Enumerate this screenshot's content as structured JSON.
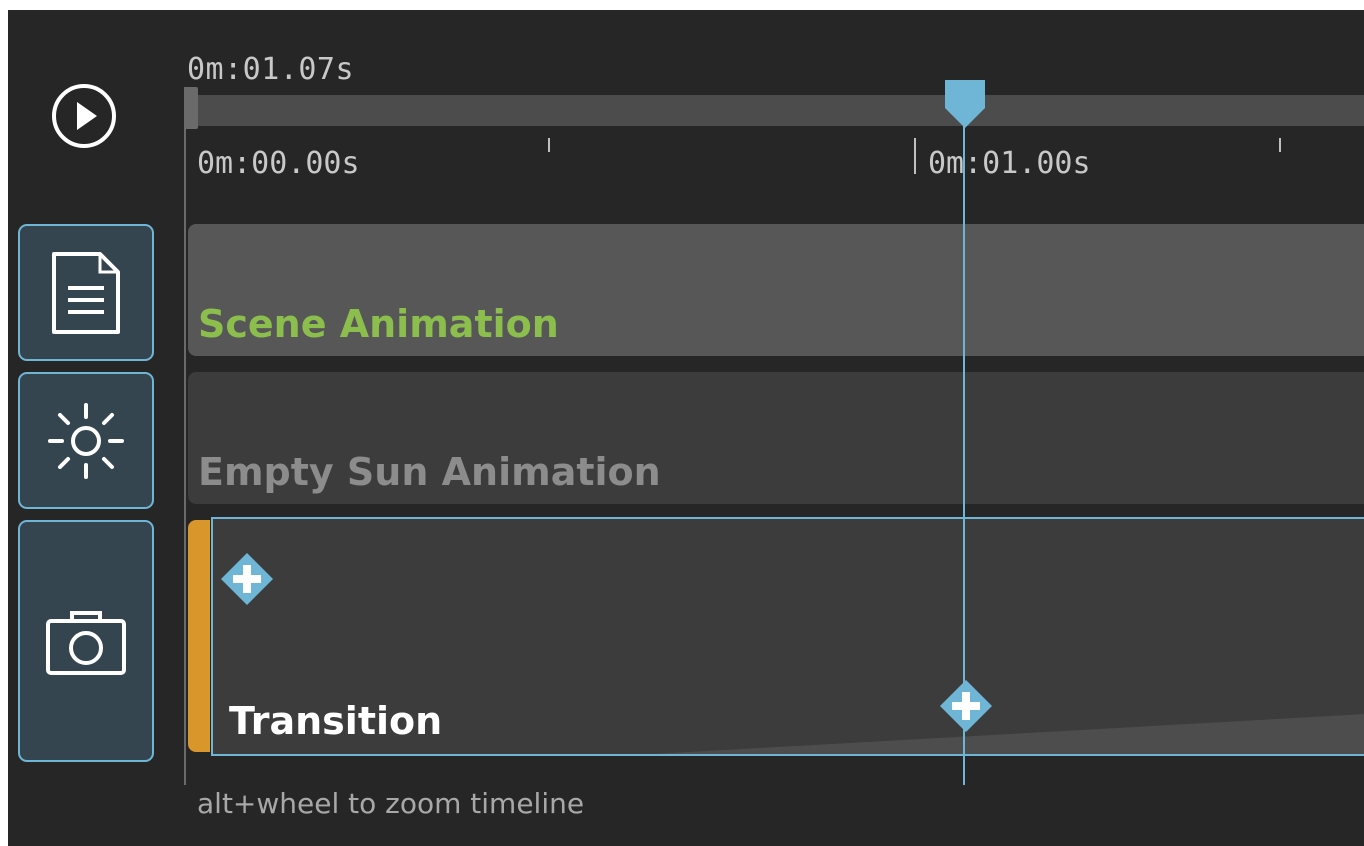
{
  "timeline": {
    "current_time": "0m:01.07s",
    "ruler": {
      "ticks": [
        {
          "label": "0m:00.00s"
        },
        {
          "label": "0m:01.00s"
        }
      ]
    },
    "tracks": [
      {
        "label": "Scene Animation",
        "color": "#8cbe4e"
      },
      {
        "label": "Empty Sun Animation",
        "color": "#8c8c8c"
      },
      {
        "label": "Transition",
        "color": "#ffffff"
      }
    ],
    "hint": "alt+wheel to zoom timeline"
  },
  "sidebar": {
    "play_icon": "play-icon",
    "buttons": [
      {
        "icon": "document-icon"
      },
      {
        "icon": "sun-icon"
      },
      {
        "icon": "camera-icon"
      }
    ]
  },
  "colors": {
    "background": "#262626",
    "accent": "#6fb5d6",
    "sidebar_button_bg": "#34454f",
    "transition_marker": "#d9962a"
  }
}
